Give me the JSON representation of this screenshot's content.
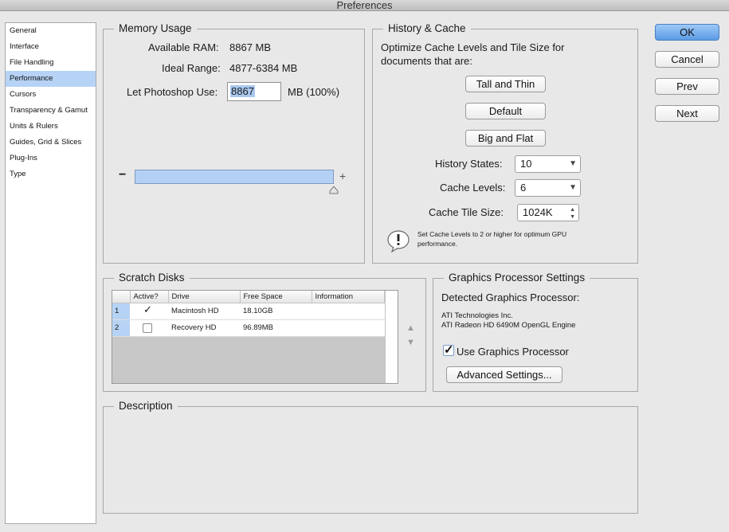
{
  "window": {
    "title": "Preferences"
  },
  "sidebar": {
    "items": [
      {
        "label": "General",
        "selected": false
      },
      {
        "label": "Interface",
        "selected": false
      },
      {
        "label": "File Handling",
        "selected": false
      },
      {
        "label": "Performance",
        "selected": true
      },
      {
        "label": "Cursors",
        "selected": false
      },
      {
        "label": "Transparency & Gamut",
        "selected": false
      },
      {
        "label": "Units & Rulers",
        "selected": false
      },
      {
        "label": "Guides, Grid & Slices",
        "selected": false
      },
      {
        "label": "Plug-Ins",
        "selected": false
      },
      {
        "label": "Type",
        "selected": false
      }
    ]
  },
  "memory": {
    "title": "Memory Usage",
    "available_label": "Available RAM:",
    "available_value": "8867 MB",
    "ideal_label": "Ideal Range:",
    "ideal_value": "4877-6384 MB",
    "use_label": "Let Photoshop Use:",
    "use_value": "8867",
    "use_unit": "MB (100%)",
    "minus": "−",
    "plus": "+",
    "slider_fraction": 1.0
  },
  "history": {
    "title": "History & Cache",
    "optimize_text_1": "Optimize Cache Levels and Tile Size for",
    "optimize_text_2": "documents that are:",
    "tall_thin": "Tall and Thin",
    "default": "Default",
    "big_flat": "Big and Flat",
    "history_states_label": "History States:",
    "history_states_value": "10",
    "cache_levels_label": "Cache Levels:",
    "cache_levels_value": "6",
    "tile_size_label": "Cache Tile Size:",
    "tile_size_value": "1024K",
    "tip_1": "Set Cache Levels to 2 or higher for optimum GPU",
    "tip_2": "performance."
  },
  "scratch": {
    "title": "Scratch Disks",
    "headers": [
      "Active?",
      "Drive",
      "Free Space",
      "Information"
    ],
    "rows": [
      {
        "num": "1",
        "active": true,
        "drive": "Macintosh HD",
        "free": "18.10GB",
        "info": ""
      },
      {
        "num": "2",
        "active": false,
        "drive": "Recovery HD",
        "free": "96.89MB",
        "info": ""
      }
    ]
  },
  "gpu": {
    "title": "Graphics Processor Settings",
    "detected_label": "Detected Graphics Processor:",
    "vendor": "ATI Technologies Inc.",
    "model": "ATI Radeon HD 6490M OpenGL Engine",
    "use_label": "Use Graphics Processor",
    "use_checked": true,
    "advanced": "Advanced Settings..."
  },
  "description": {
    "title": "Description"
  },
  "buttons": {
    "ok": "OK",
    "cancel": "Cancel",
    "prev": "Prev",
    "next": "Next"
  },
  "colors": {
    "accent": "#5b9be5",
    "selection": "#b6d3f5"
  }
}
